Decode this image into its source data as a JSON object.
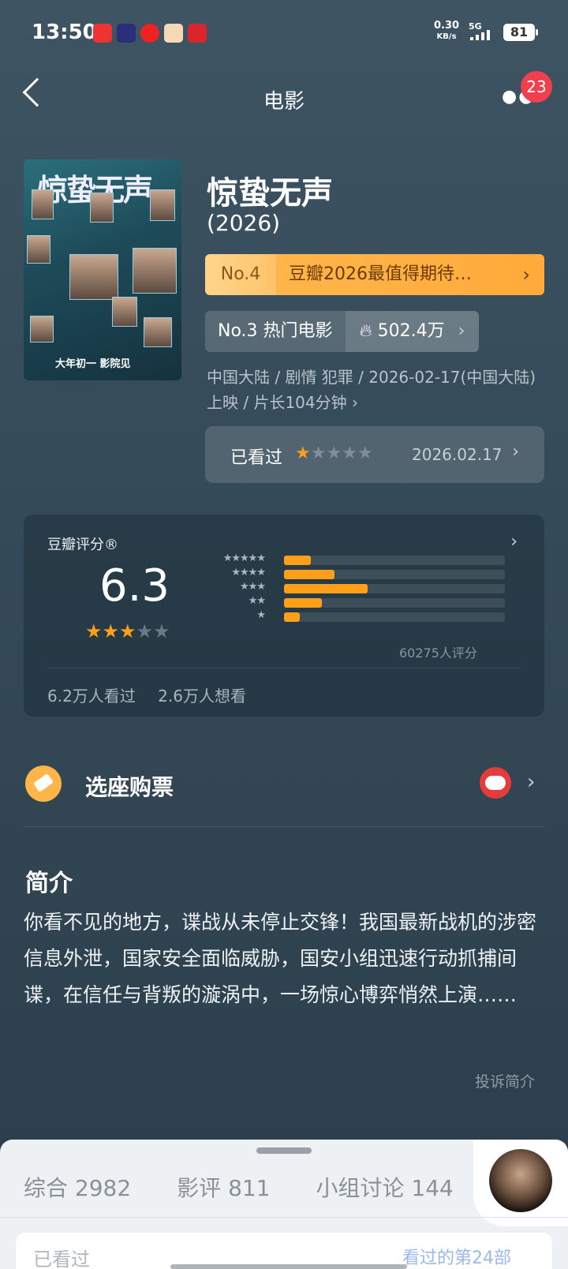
{
  "status": {
    "time": "13:50",
    "speed_value": "0.30",
    "speed_unit": "KB/s",
    "network": "5G",
    "battery": "81",
    "app_icons": [
      "toutiao-icon",
      "tv-icon",
      "netease-music-icon",
      "pet-icon",
      "dark-red-app-icon"
    ]
  },
  "nav": {
    "title": "电影",
    "badge": "23"
  },
  "movie": {
    "title": "惊蛰无声",
    "year": "(2026)",
    "poster_title": "惊蛰无声",
    "poster_bottom": "大年初一 影院见",
    "rank1_no": "No.4",
    "rank1_text": "豆瓣2026最值得期待…",
    "rank2_text": "No.3 热门电影",
    "heat": "502.4万",
    "meta": "中国大陆 / 剧情 犯罪 / 2026-02-17(中国大陆)上映 / 片长104分钟 ›",
    "watched_label": "已看过",
    "watched_date": "2026.02.17",
    "my_rating": 1
  },
  "rating": {
    "header": "豆瓣评分®",
    "score": "6.3",
    "stars": 3,
    "distribution": [
      {
        "stars": 5,
        "label": "★★★★★",
        "fraction": 0.12
      },
      {
        "stars": 4,
        "label": "★★★★",
        "fraction": 0.23
      },
      {
        "stars": 3,
        "label": "★★★",
        "fraction": 0.38
      },
      {
        "stars": 2,
        "label": "★★",
        "fraction": 0.17
      },
      {
        "stars": 1,
        "label": "★",
        "fraction": 0.07
      }
    ],
    "count": "60275人评分",
    "seen": "6.2万人看过",
    "want": "2.6万人想看"
  },
  "ticket": {
    "label": "选座购票"
  },
  "intro": {
    "heading": "简介",
    "text": "你看不见的地方，谍战从未停止交锋！我国最新战机的涉密信息外泄，国家安全面临威胁，国安小组迅速行动抓捕间谍，在信任与背叛的漩涡中，一场惊心博弈悄然上演……",
    "report": "投诉简介"
  },
  "tabs": [
    {
      "label": "综合 2982"
    },
    {
      "label": "影评 811"
    },
    {
      "label": "小组讨论 144"
    }
  ],
  "bottom": {
    "left": "已看过",
    "right": "看过的第24部"
  },
  "colors": {
    "accent": "#ff9f1a",
    "badge": "#f0404e",
    "rank_gold": "#ffb54a"
  }
}
